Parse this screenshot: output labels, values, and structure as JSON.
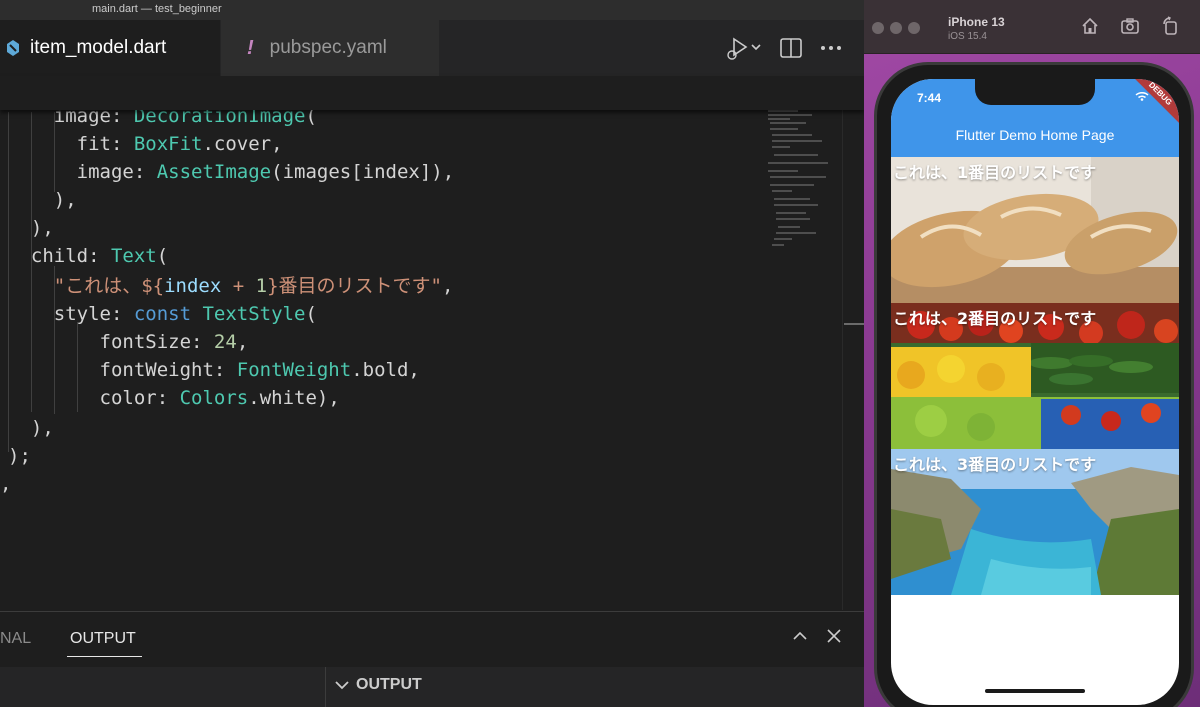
{
  "window": {
    "title": "main.dart — test_beginner"
  },
  "tabs": [
    {
      "label": "item_model.dart",
      "icon": "dart-file-icon"
    },
    {
      "label": "pubspec.yaml",
      "icon": "yaml-file-icon",
      "icon_glyph": "!"
    }
  ],
  "code": {
    "lines": [
      {
        "tokens": [
          [
            "    ",
            ""
          ],
          [
            "image",
            ""
          ],
          [
            ": ",
            ""
          ],
          [
            "DecorationImage",
            "t"
          ],
          [
            "(",
            ""
          ]
        ]
      },
      {
        "tokens": [
          [
            "      fit",
            ""
          ],
          [
            ": ",
            ""
          ],
          [
            "BoxFit",
            "t"
          ],
          [
            ".cover,",
            ""
          ]
        ]
      },
      {
        "tokens": [
          [
            "      image",
            ""
          ],
          [
            ": ",
            ""
          ],
          [
            "AssetImage",
            "t"
          ],
          [
            "(images[index]),",
            ""
          ]
        ]
      },
      {
        "tokens": [
          [
            "    ),",
            ""
          ]
        ]
      },
      {
        "tokens": [
          [
            "  ),",
            ""
          ]
        ]
      },
      {
        "tokens": [
          [
            "  child",
            ""
          ],
          [
            ": ",
            ""
          ],
          [
            "Text",
            "t"
          ],
          [
            "(",
            ""
          ]
        ]
      },
      {
        "tokens": [
          [
            "    ",
            ""
          ],
          [
            "\"これは、${",
            "s"
          ],
          [
            "index",
            "v"
          ],
          [
            " + ",
            "s"
          ],
          [
            "1",
            "n"
          ],
          [
            "}番目のリストです\"",
            "s"
          ],
          [
            ",",
            ""
          ]
        ]
      },
      {
        "tokens": [
          [
            "    style",
            ""
          ],
          [
            ": ",
            ""
          ],
          [
            "const ",
            "k"
          ],
          [
            "TextStyle",
            "t"
          ],
          [
            "(",
            ""
          ]
        ]
      },
      {
        "tokens": [
          [
            "        fontSize",
            ""
          ],
          [
            ": ",
            ""
          ],
          [
            "24",
            "n"
          ],
          [
            ",",
            ""
          ]
        ]
      },
      {
        "tokens": [
          [
            "        fontWeight",
            ""
          ],
          [
            ": ",
            ""
          ],
          [
            "FontWeight",
            "t"
          ],
          [
            ".bold,",
            ""
          ]
        ]
      },
      {
        "tokens": [
          [
            "        color",
            ""
          ],
          [
            ": ",
            ""
          ],
          [
            "Colors",
            "t"
          ],
          [
            ".white),",
            ""
          ]
        ]
      },
      {
        "tokens": [
          [
            "  ),",
            ""
          ]
        ]
      },
      {
        "tokens": [
          [
            "); ",
            ""
          ]
        ]
      },
      {
        "tokens": [
          [
            ",",
            ""
          ]
        ]
      }
    ]
  },
  "panel": {
    "tabs": [
      "NAL",
      "OUTPUT"
    ],
    "active_tab": "OUTPUT",
    "section_title": "OUTPUT"
  },
  "simulator": {
    "device_name": "iPhone 13",
    "os_version": "iOS 15.4",
    "status_time": "7:44",
    "debug_banner": "DEBUG",
    "app_title": "Flutter Demo Home Page",
    "items": [
      {
        "label": "これは、1番目のリストです",
        "image": "bread-image"
      },
      {
        "label": "これは、2番目のリストです",
        "image": "vegetables-image"
      },
      {
        "label": "これは、3番目のリストです",
        "image": "coast-image"
      }
    ]
  },
  "colors": {
    "editor_bg": "#1e1e1e",
    "appbar": "#3f95ea",
    "keyword": "#569cd6",
    "type": "#4ec9b0",
    "string": "#ce9178",
    "number": "#b5cea8"
  }
}
